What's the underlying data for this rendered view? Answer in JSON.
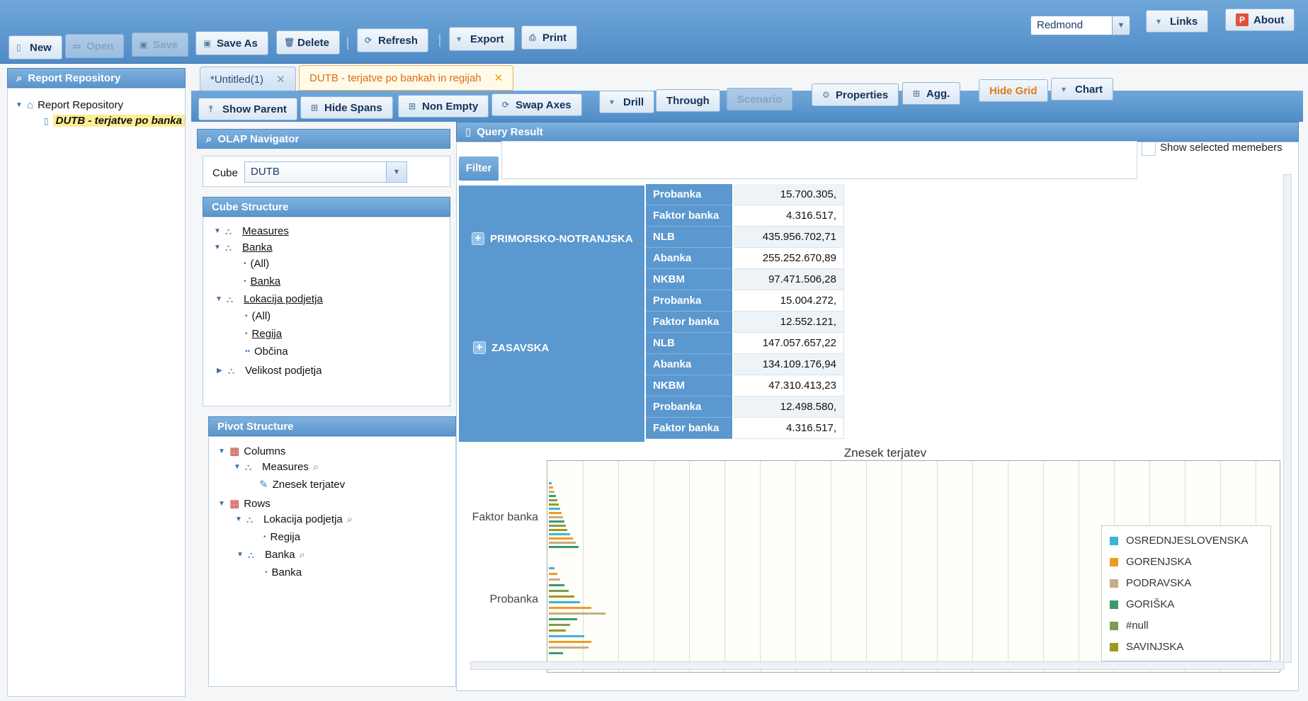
{
  "toolbar": {
    "new": "New",
    "open": "Open",
    "save": "Save",
    "save_as": "Save As",
    "delete": "Delete",
    "refresh": "Refresh",
    "export": "Export",
    "print": "Print",
    "city": "Redmond",
    "links": "Links",
    "about": "About"
  },
  "repo": {
    "header": "Report Repository",
    "root": "Report Repository",
    "item": "DUTB - terjatve po banka"
  },
  "tabs": [
    {
      "label": "*Untitled(1)"
    },
    {
      "label": "DUTB - terjatve po bankah in regijah"
    }
  ],
  "tb2": {
    "show_parent": "Show Parent",
    "hide_spans": "Hide Spans",
    "non_empty": "Non Empty",
    "swap_axes": "Swap Axes",
    "drill": "Drill",
    "through": "Through",
    "scenario": "Scenario",
    "properties": "Properties",
    "agg": "Agg.",
    "hide_grid": "Hide Grid",
    "chart": "Chart"
  },
  "olap": {
    "header": "OLAP Navigator",
    "cube_label": "Cube",
    "cube_value": "DUTB"
  },
  "cube_structure": {
    "header": "Cube Structure",
    "measures": "Measures",
    "banka": "Banka",
    "all1": "(All)",
    "banka_level": "Banka",
    "lokacija": "Lokacija podjetja",
    "all2": "(All)",
    "regija": "Regija",
    "obcina": "Občina",
    "velikost": "Velikost podjetja"
  },
  "pivot": {
    "header": "Pivot Structure",
    "columns": "Columns",
    "measures": "Measures",
    "znesek": "Znesek terjatev",
    "rows": "Rows",
    "lokacija": "Lokacija podjetja",
    "regija": "Regija",
    "banka": "Banka",
    "banka_level": "Banka"
  },
  "query": {
    "header": "Query Result",
    "filter": "Filter",
    "show_selected": "Show selected memebers"
  },
  "grid": {
    "top_rows": [
      {
        "bank": "Probanka",
        "value": "15.700.305,"
      },
      {
        "bank": "Faktor banka",
        "value": "4.316.517,"
      }
    ],
    "regions": [
      {
        "name": "PRIMORSKO-NOTRANJSKA",
        "rows": [
          {
            "bank": "NLB",
            "value": "435.956.702,71"
          },
          {
            "bank": "Abanka",
            "value": "255.252.670,89"
          },
          {
            "bank": "NKBM",
            "value": "97.471.506,28"
          },
          {
            "bank": "Probanka",
            "value": "15.004.272,"
          },
          {
            "bank": "Faktor banka",
            "value": "12.552.121,"
          }
        ]
      },
      {
        "name": "ZASAVSKA",
        "rows": [
          {
            "bank": "NLB",
            "value": "147.057.657,22"
          },
          {
            "bank": "Abanka",
            "value": "134.109.176,94"
          },
          {
            "bank": "NKBM",
            "value": "47.310.413,23"
          },
          {
            "bank": "Probanka",
            "value": "12.498.580,"
          },
          {
            "bank": "Faktor banka",
            "value": "4.316.517,"
          }
        ]
      }
    ]
  },
  "chart_data": {
    "type": "bar",
    "title": "Znesek terjatev",
    "categories": [
      "Faktor banka",
      "Probanka"
    ],
    "series": [
      {
        "name": "OSREDNJESLOVENSKA"
      },
      {
        "name": "GORENJSKA"
      },
      {
        "name": "PODRAVSKA"
      },
      {
        "name": "GORIŠKA"
      },
      {
        "name": "#null"
      },
      {
        "name": "SAVINJSKA"
      }
    ],
    "legend_position": "right",
    "grid": true
  },
  "legend_colors": [
    "#3fb3d6",
    "#f29a1e",
    "#c7ad82",
    "#3c9a6a",
    "#7f9a52",
    "#9a9a1c"
  ]
}
